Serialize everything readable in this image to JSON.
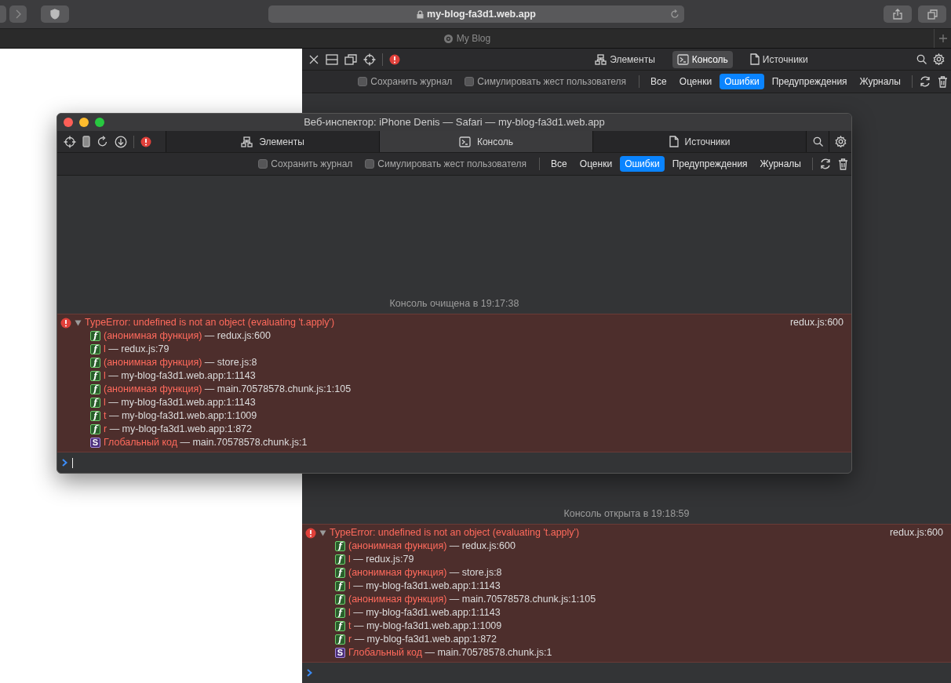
{
  "browser": {
    "address": "my-blog-fa3d1.web.app",
    "tab_title": "My Blog"
  },
  "docked_inspector": {
    "tabs": [
      {
        "label": "Элементы",
        "kind": "elements",
        "selected": false
      },
      {
        "label": "Консоль",
        "kind": "console",
        "selected": true
      },
      {
        "label": "Источники",
        "kind": "sources",
        "selected": false
      }
    ],
    "options": [
      {
        "label": "Сохранить журнал",
        "checked": false
      },
      {
        "label": "Симулировать жест пользователя",
        "checked": false
      }
    ],
    "levels": [
      {
        "label": "Все",
        "selected": false
      },
      {
        "label": "Оценки",
        "selected": false
      },
      {
        "label": "Ошибки",
        "selected": true
      },
      {
        "label": "Предупреждения",
        "selected": false
      },
      {
        "label": "Журналы",
        "selected": false
      }
    ],
    "console": {
      "notice": "Консоль открыта в 19:18:59",
      "error": {
        "message": "TypeError: undefined is not an object (evaluating 't.apply')",
        "location": "redux.js:600",
        "expanded": true,
        "frames": [
          {
            "kind": "function",
            "badge": "f",
            "name": "(анонимная функция)",
            "separator": "—",
            "location": "redux.js:600"
          },
          {
            "kind": "function",
            "badge": "f",
            "name": "l",
            "separator": "—",
            "location": "redux.js:79"
          },
          {
            "kind": "function",
            "badge": "f",
            "name": "(анонимная функция)",
            "separator": "—",
            "location": "store.js:8"
          },
          {
            "kind": "function",
            "badge": "f",
            "name": "l",
            "separator": "—",
            "location": "my-blog-fa3d1.web.app:1:1143"
          },
          {
            "kind": "function",
            "badge": "f",
            "name": "(анонимная функция)",
            "separator": "—",
            "location": "main.70578578.chunk.js:1:105"
          },
          {
            "kind": "function",
            "badge": "f",
            "name": "l",
            "separator": "—",
            "location": "my-blog-fa3d1.web.app:1:1143"
          },
          {
            "kind": "function",
            "badge": "f",
            "name": "t",
            "separator": "—",
            "location": "my-blog-fa3d1.web.app:1:1009"
          },
          {
            "kind": "function",
            "badge": "f",
            "name": "r",
            "separator": "—",
            "location": "my-blog-fa3d1.web.app:1:872"
          },
          {
            "kind": "global",
            "badge": "S",
            "name": "Глобальный код",
            "separator": "—",
            "location": "main.70578578.chunk.js:1"
          }
        ]
      }
    }
  },
  "floating_inspector": {
    "title": "Веб-инспектор: iPhone Denis — Safari — my-blog-fa3d1.web.app",
    "tabs": [
      {
        "label": "Элементы",
        "kind": "elements",
        "selected": false
      },
      {
        "label": "Консоль",
        "kind": "console",
        "selected": true
      },
      {
        "label": "Источники",
        "kind": "sources",
        "selected": false
      }
    ],
    "options": [
      {
        "label": "Сохранить журнал",
        "checked": false
      },
      {
        "label": "Симулировать жест пользователя",
        "checked": false
      }
    ],
    "levels": [
      {
        "label": "Все",
        "selected": false
      },
      {
        "label": "Оценки",
        "selected": false
      },
      {
        "label": "Ошибки",
        "selected": true
      },
      {
        "label": "Предупреждения",
        "selected": false
      },
      {
        "label": "Журналы",
        "selected": false
      }
    ],
    "console": {
      "notice": "Консоль очищена в 19:17:38",
      "error": {
        "message": "TypeError: undefined is not an object (evaluating 't.apply')",
        "location": "redux.js:600",
        "expanded": true,
        "frames": [
          {
            "kind": "function",
            "badge": "f",
            "name": "(анонимная функция)",
            "separator": "—",
            "location": "redux.js:600"
          },
          {
            "kind": "function",
            "badge": "f",
            "name": "l",
            "separator": "—",
            "location": "redux.js:79"
          },
          {
            "kind": "function",
            "badge": "f",
            "name": "(анонимная функция)",
            "separator": "—",
            "location": "store.js:8"
          },
          {
            "kind": "function",
            "badge": "f",
            "name": "l",
            "separator": "—",
            "location": "my-blog-fa3d1.web.app:1:1143"
          },
          {
            "kind": "function",
            "badge": "f",
            "name": "(анонимная функция)",
            "separator": "—",
            "location": "main.70578578.chunk.js:1:105"
          },
          {
            "kind": "function",
            "badge": "f",
            "name": "l",
            "separator": "—",
            "location": "my-blog-fa3d1.web.app:1:1143"
          },
          {
            "kind": "function",
            "badge": "f",
            "name": "t",
            "separator": "—",
            "location": "my-blog-fa3d1.web.app:1:1009"
          },
          {
            "kind": "function",
            "badge": "f",
            "name": "r",
            "separator": "—",
            "location": "my-blog-fa3d1.web.app:1:872"
          },
          {
            "kind": "global",
            "badge": "S",
            "name": "Глобальный код",
            "separator": "—",
            "location": "main.70578578.chunk.js:1"
          }
        ]
      }
    }
  }
}
